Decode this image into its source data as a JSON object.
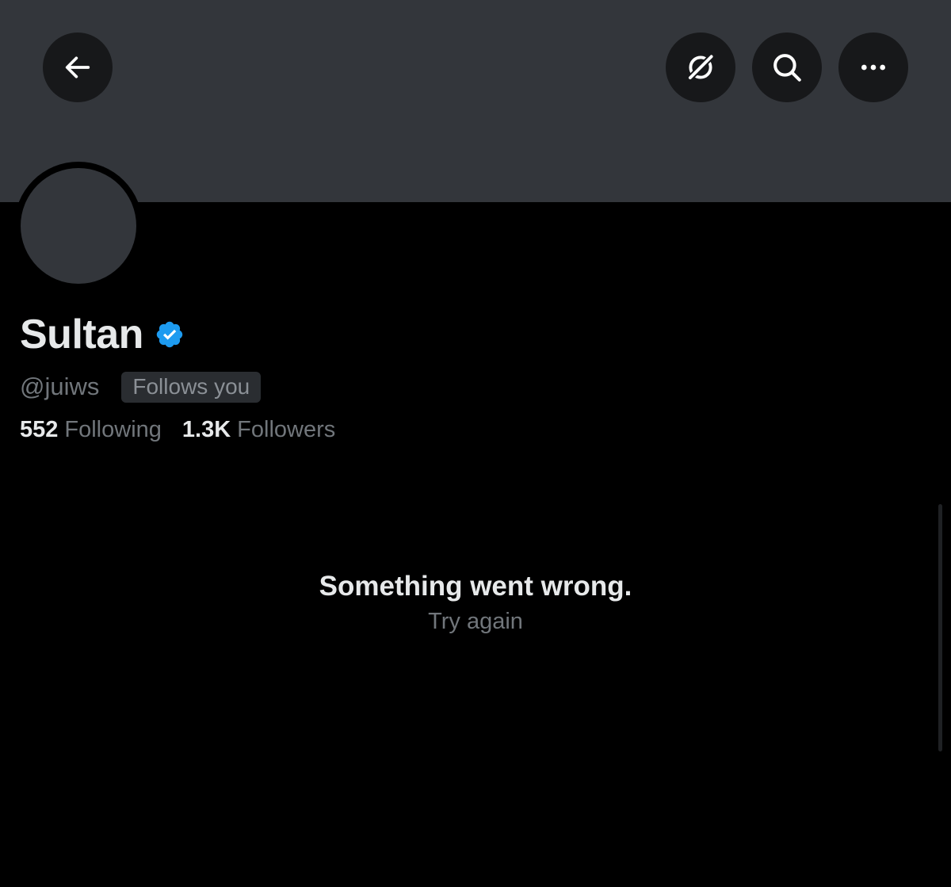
{
  "header": {
    "back_icon": "arrow-left-icon",
    "grok_icon": "grok-icon",
    "search_icon": "search-icon",
    "more_icon": "more-horizontal-icon",
    "banner_color": "#33363b"
  },
  "profile": {
    "display_name": "Sultan",
    "verified": true,
    "verified_color": "#1d9bf0",
    "handle": "@juiws",
    "follows_you_label": "Follows you",
    "following_count": "552",
    "following_label": "Following",
    "followers_count": "1.3K",
    "followers_label": "Followers"
  },
  "error": {
    "message": "Something went wrong.",
    "retry_label": "Try again"
  }
}
